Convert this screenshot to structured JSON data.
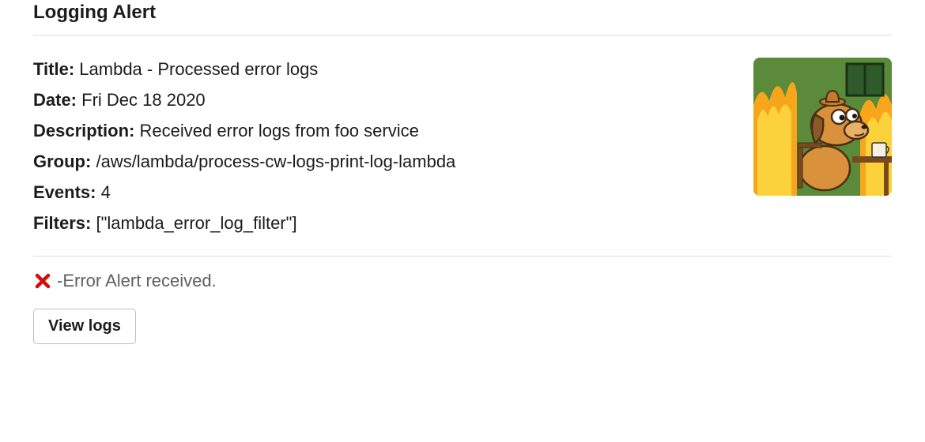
{
  "header": {
    "title": "Logging Alert"
  },
  "details": {
    "title_label": "Title:",
    "title_value": "Lambda - Processed error logs",
    "date_label": "Date:",
    "date_value": "Fri Dec 18 2020",
    "description_label": "Description:",
    "description_value": "Received error logs from foo service",
    "group_label": "Group:",
    "group_value": "/aws/lambda/process-cw-logs-print-log-lambda",
    "events_label": "Events:",
    "events_value": "4",
    "filters_label": "Filters:",
    "filters_value": "[\"lambda_error_log_filter\"]"
  },
  "thumbnail": {
    "name": "this-is-fine-dog"
  },
  "status": {
    "icon": "cross-x-icon",
    "separator": " - ",
    "text": "Error Alert received."
  },
  "actions": {
    "view_logs_label": "View logs"
  },
  "colors": {
    "error_red": "#d40e0d",
    "text_primary": "#1d1c1d",
    "text_secondary": "#616061",
    "divider": "#dddddd",
    "button_border": "#bfbfbf"
  }
}
